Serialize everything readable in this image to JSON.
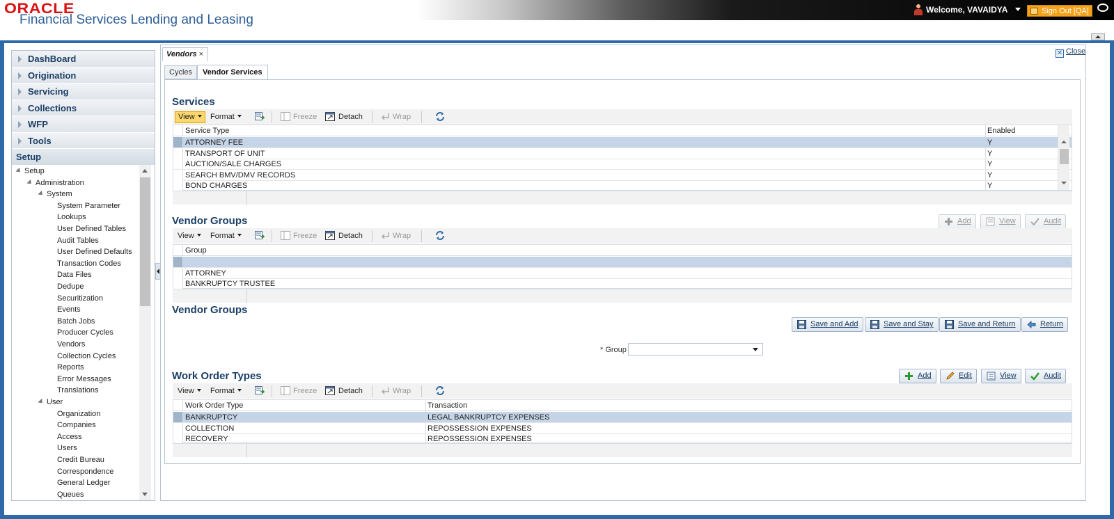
{
  "header": {
    "logo_text": "ORACLE",
    "product_name": "Financial Services Lending and Leasing",
    "welcome_text": "Welcome, VAVAIDYA",
    "sign_out_label": "Sign Out [QA]"
  },
  "nav": {
    "items": [
      {
        "label": "DashBoard"
      },
      {
        "label": "Origination"
      },
      {
        "label": "Servicing"
      },
      {
        "label": "Collections"
      },
      {
        "label": "WFP"
      },
      {
        "label": "Tools"
      }
    ],
    "setup_label": "Setup",
    "tree": [
      {
        "label": "Setup",
        "level": 0,
        "expander": true
      },
      {
        "label": "Administration",
        "level": 1,
        "expander": true
      },
      {
        "label": "System",
        "level": 2,
        "expander": true
      },
      {
        "label": "System Parameter",
        "level": 3
      },
      {
        "label": "Lookups",
        "level": 3
      },
      {
        "label": "User Defined Tables",
        "level": 3
      },
      {
        "label": "Audit Tables",
        "level": 3
      },
      {
        "label": "User Defined Defaults",
        "level": 3
      },
      {
        "label": "Transaction Codes",
        "level": 3
      },
      {
        "label": "Data Files",
        "level": 3
      },
      {
        "label": "Dedupe",
        "level": 3
      },
      {
        "label": "Securitization",
        "level": 3
      },
      {
        "label": "Events",
        "level": 3
      },
      {
        "label": "Batch Jobs",
        "level": 3
      },
      {
        "label": "Producer Cycles",
        "level": 3
      },
      {
        "label": "Vendors",
        "level": 3
      },
      {
        "label": "Collection Cycles",
        "level": 3
      },
      {
        "label": "Reports",
        "level": 3
      },
      {
        "label": "Error Messages",
        "level": 3
      },
      {
        "label": "Translations",
        "level": 3
      },
      {
        "label": "User",
        "level": 2,
        "expander": true
      },
      {
        "label": "Organization",
        "level": 3
      },
      {
        "label": "Companies",
        "level": 3
      },
      {
        "label": "Access",
        "level": 3
      },
      {
        "label": "Users",
        "level": 3
      },
      {
        "label": "Credit Bureau",
        "level": 3
      },
      {
        "label": "Correspondence",
        "level": 3
      },
      {
        "label": "General Ledger",
        "level": 3
      },
      {
        "label": "Queues",
        "level": 3
      }
    ]
  },
  "document_tab": {
    "label": "Vendors",
    "close_glyph": "×"
  },
  "close_label": "Close",
  "subtabs": {
    "cycles": "Cycles",
    "vendor_services": "Vendor Services"
  },
  "toolbar": {
    "view": "View",
    "format": "Format",
    "freeze": "Freeze",
    "detach": "Detach",
    "wrap": "Wrap"
  },
  "services": {
    "title": "Services",
    "columns": [
      "Service Type",
      "Enabled"
    ],
    "rows": [
      [
        "ATTORNEY FEE",
        "Y"
      ],
      [
        "TRANSPORT OF UNIT",
        "Y"
      ],
      [
        "AUCTION/SALE CHARGES",
        "Y"
      ],
      [
        "SEARCH BMV/DMV RECORDS",
        "Y"
      ],
      [
        "BOND CHARGES",
        "Y"
      ]
    ]
  },
  "vendor_groups": {
    "title": "Vendor Groups",
    "buttons": {
      "add": "Add",
      "view": "View",
      "audit": "Audit"
    },
    "columns": [
      "Group"
    ],
    "rows": [
      [
        ""
      ],
      [
        "ATTORNEY"
      ],
      [
        "BANKRUPTCY TRUSTEE"
      ]
    ]
  },
  "vendor_groups_form": {
    "title": "Vendor Groups",
    "buttons": {
      "save_and_add": "Save and Add",
      "save_and_stay": "Save and Stay",
      "save_and_return": "Save and Return",
      "return": "Return"
    },
    "group_label": "* Group",
    "group_value": ""
  },
  "work_order_types": {
    "title": "Work Order Types",
    "buttons": {
      "add": "Add",
      "edit": "Edit",
      "view": "View",
      "audit": "Audit"
    },
    "columns": [
      "Work Order Type",
      "Transaction"
    ],
    "rows": [
      [
        "BANKRUPTCY",
        "LEGAL BANKRUPTCY EXPENSES"
      ],
      [
        "COLLECTION",
        "REPOSSESSION EXPENSES"
      ],
      [
        "RECOVERY",
        "REPOSSESSION EXPENSES"
      ]
    ]
  }
}
